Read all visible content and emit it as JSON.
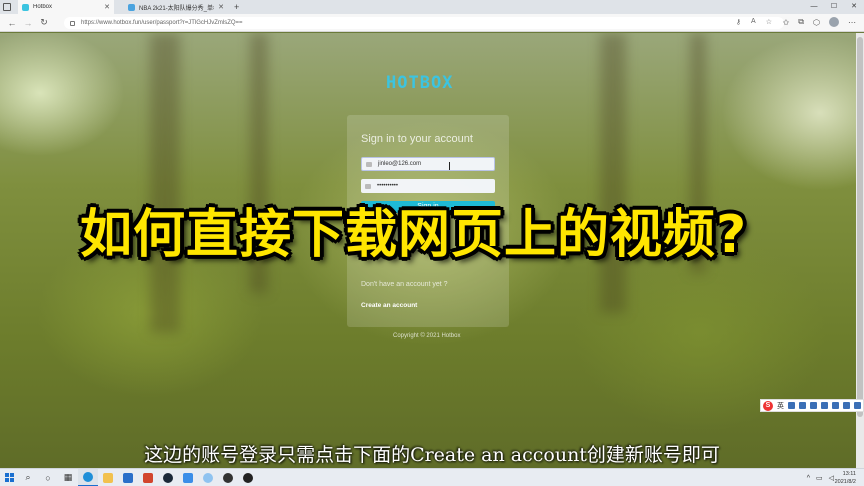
{
  "browser": {
    "tabs": [
      {
        "label": "Hotbox",
        "active": true,
        "icon_color": "#3cc4e0"
      },
      {
        "label": "NBA 2k21-太阳队爆分秀_单机游",
        "active": false,
        "icon_color": "#4aa3df"
      }
    ],
    "new_tab_label": "+",
    "url": "https://www.hotbox.fun/user/passport?r=JTlGcHJvZmlsZQ==",
    "window_controls": [
      "—",
      "☐",
      "✕"
    ]
  },
  "page": {
    "logo": "HOTBOX",
    "login": {
      "title": "Sign in to your account",
      "email_value": "jinleo@126.com",
      "password_value": "••••••••••",
      "signin_label": "Sign in",
      "no_account_text": "Don't have an account yet ?",
      "create_account_label": "Create an account"
    },
    "copyright": "Copyright © 2021 Hotbox",
    "accent_color": "#1ebad6"
  },
  "overlay": {
    "title": "如何直接下载网页上的视频?",
    "subtitle": "这边的账号登录只需点击下面的Create an account创建新账号即可"
  },
  "ime": {
    "logo": "S",
    "mode": "英"
  },
  "taskbar": {
    "icons": [
      "windows-icon",
      "search-icon",
      "task-view-icon",
      "widgets-icon",
      "edge-icon",
      "explorer-icon",
      "mail-icon",
      "powerpoint-icon",
      "steam-icon",
      "store-icon",
      "browser-icon",
      "app-icon",
      "app2-icon"
    ],
    "tray_chevron": "^",
    "time": "13:11",
    "date": "2021/8/2"
  }
}
